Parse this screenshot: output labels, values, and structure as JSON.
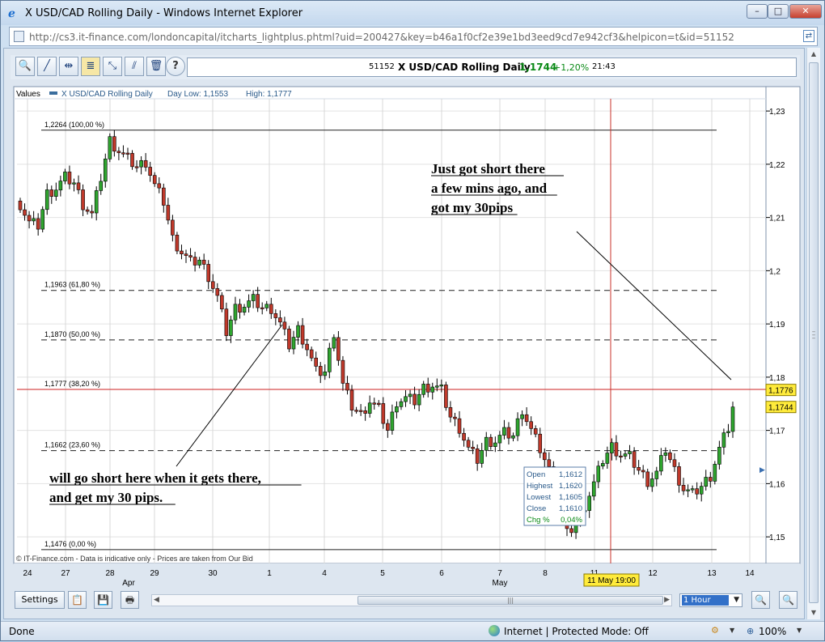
{
  "window": {
    "title": "X USD/CAD Rolling Daily - Windows Internet Explorer",
    "minimize": "–",
    "maximize": "□",
    "close": "✕"
  },
  "address": {
    "url": "http://cs3.it-finance.com/londoncapital/itcharts_lightplus.phtml?uid=200427&key=b46a1f0cf2e39e1bd3eed9cd7e942cf3&helpicon=t&id=51152"
  },
  "toolbar": {
    "symbol_id": "51152",
    "symbol_name": "X USD/CAD Rolling Daily",
    "price": "1,1744",
    "change": "+1,20%",
    "time": "21:43",
    "help": "?"
  },
  "chart_data": {
    "type": "candlestick",
    "title": "X USD/CAD Rolling Daily",
    "legend_label": "Values",
    "day_low": "Day Low: 1,1553",
    "day_high": "High: 1,1777",
    "x_tick_labels": [
      "24",
      "27",
      "28",
      "29",
      "30",
      "1",
      "4",
      "5",
      "6",
      "7",
      "8",
      "11",
      "12",
      "13",
      "14"
    ],
    "month_labels": [
      "Apr",
      "May"
    ],
    "y_ticks": [
      1.15,
      1.16,
      1.17,
      1.18,
      1.19,
      1.2,
      1.21,
      1.22,
      1.23
    ],
    "y_tick_labels": [
      "1,15",
      "1,16",
      "1,17",
      "1,18",
      "1,19",
      "1,2",
      "1,21",
      "1,22",
      "1,23"
    ],
    "ylim": [
      1.145,
      1.2323
    ],
    "fib_levels": [
      {
        "value": 1.2264,
        "label": "1,2264 (100,00 %)",
        "style": "solid"
      },
      {
        "value": 1.1963,
        "label": "1,1963 (61,80 %)",
        "style": "dashed"
      },
      {
        "value": 1.187,
        "label": "1,1870 (50,00 %)",
        "style": "dashed"
      },
      {
        "value": 1.1777,
        "label": "1,1777 (38,20 %)",
        "style": "red"
      },
      {
        "value": 1.1662,
        "label": "1,1662 (23,60 %)",
        "style": "dashed"
      },
      {
        "value": 1.1476,
        "label": "1,1476 (0,00 %)",
        "style": "solid"
      }
    ],
    "price_tags": [
      {
        "value": 1.1776,
        "label": "1,1776"
      },
      {
        "value": 1.1744,
        "label": "1,1744"
      }
    ],
    "crosshair_label": "11 May 19:00",
    "ohlc_box": {
      "rows": [
        {
          "label": "Open",
          "value": "1,1612"
        },
        {
          "label": "Highest",
          "value": "1,1620"
        },
        {
          "label": "Lowest",
          "value": "1,1605"
        },
        {
          "label": "Close",
          "value": "1,1610"
        },
        {
          "label": "Chg %",
          "value": "0,04%"
        }
      ]
    },
    "annotations": [
      {
        "lines": [
          "Just got short there",
          "a few mins ago, and",
          "got my 30pips"
        ]
      },
      {
        "lines": [
          "will go short here when it gets there,",
          "and get my 30 pips."
        ]
      }
    ],
    "price_path": [
      [
        0,
        1.2125
      ],
      [
        2,
        1.209
      ],
      [
        4,
        1.2085
      ],
      [
        6,
        1.2145
      ],
      [
        8,
        1.2155
      ],
      [
        10,
        1.2175
      ],
      [
        12,
        1.2165
      ],
      [
        14,
        1.2125
      ],
      [
        16,
        1.2105
      ],
      [
        18,
        1.2175
      ],
      [
        20,
        1.2245
      ],
      [
        22,
        1.2225
      ],
      [
        24,
        1.221
      ],
      [
        26,
        1.2195
      ],
      [
        28,
        1.2205
      ],
      [
        30,
        1.216
      ],
      [
        32,
        1.213
      ],
      [
        34,
        1.206
      ],
      [
        36,
        1.2035
      ],
      [
        38,
        1.2015
      ],
      [
        40,
        1.202
      ],
      [
        42,
        1.199
      ],
      [
        44,
        1.195
      ],
      [
        46,
        1.1885
      ],
      [
        48,
        1.193
      ],
      [
        50,
        1.1935
      ],
      [
        52,
        1.1945
      ],
      [
        54,
        1.193
      ],
      [
        56,
        1.193
      ],
      [
        58,
        1.19
      ],
      [
        60,
        1.186
      ],
      [
        62,
        1.189
      ],
      [
        64,
        1.1855
      ],
      [
        66,
        1.181
      ],
      [
        68,
        1.181
      ],
      [
        70,
        1.1885
      ],
      [
        72,
        1.1785
      ],
      [
        74,
        1.1745
      ],
      [
        76,
        1.173
      ],
      [
        78,
        1.1755
      ],
      [
        80,
        1.174
      ],
      [
        82,
        1.17
      ],
      [
        84,
        1.1755
      ],
      [
        86,
        1.176
      ],
      [
        88,
        1.1755
      ],
      [
        90,
        1.178
      ],
      [
        92,
        1.1785
      ],
      [
        94,
        1.1775
      ],
      [
        96,
        1.1725
      ],
      [
        98,
        1.1705
      ],
      [
        100,
        1.1665
      ],
      [
        102,
        1.1645
      ],
      [
        104,
        1.168
      ],
      [
        106,
        1.168
      ],
      [
        108,
        1.1695
      ],
      [
        110,
        1.169
      ],
      [
        112,
        1.174
      ],
      [
        114,
        1.17
      ],
      [
        116,
        1.1665
      ],
      [
        118,
        1.1625
      ],
      [
        120,
        1.1555
      ],
      [
        122,
        1.1505
      ],
      [
        124,
        1.1525
      ],
      [
        126,
        1.156
      ],
      [
        128,
        1.16
      ],
      [
        130,
        1.1645
      ],
      [
        132,
        1.167
      ],
      [
        134,
        1.1655
      ],
      [
        136,
        1.165
      ],
      [
        138,
        1.1625
      ],
      [
        140,
        1.1605
      ],
      [
        142,
        1.162
      ],
      [
        144,
        1.1665
      ],
      [
        146,
        1.1625
      ],
      [
        148,
        1.159
      ],
      [
        150,
        1.158
      ],
      [
        152,
        1.1595
      ],
      [
        154,
        1.1615
      ],
      [
        156,
        1.1665
      ],
      [
        158,
        1.1705
      ],
      [
        159,
        1.1744
      ]
    ]
  },
  "bottom": {
    "settings": "Settings",
    "timeframe": "1 Hour",
    "hs_grip": "|||"
  },
  "status": {
    "text": "Done",
    "zone": "Internet | Protected Mode: Off",
    "zoom": "100%"
  }
}
